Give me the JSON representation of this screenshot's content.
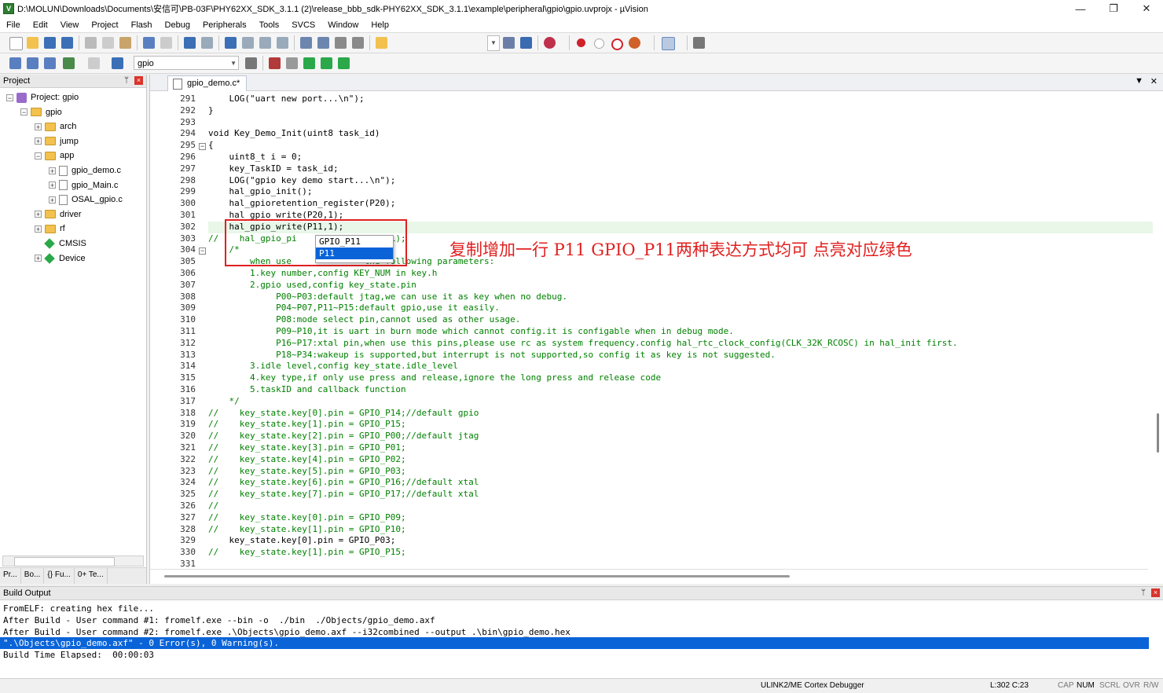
{
  "window": {
    "title": "D:\\MOLUN\\Downloads\\Documents\\安信可\\PB-03F\\PHY62XX_SDK_3.1.1 (2)\\release_bbb_sdk-PHY62XX_SDK_3.1.1\\example\\peripheral\\gpio\\gpio.uvprojx - µVision",
    "minimize": "—",
    "maximize": "❐",
    "close": "✕"
  },
  "menu": [
    "File",
    "Edit",
    "View",
    "Project",
    "Flash",
    "Debug",
    "Peripherals",
    "Tools",
    "SVCS",
    "Window",
    "Help"
  ],
  "toolbar2": {
    "target": "gpio"
  },
  "project_panel": {
    "title": "Project",
    "pin": "ᛘ",
    "close": "×",
    "tree": [
      {
        "label": "Project: gpio",
        "level": 0,
        "kind": "project",
        "exp": "−"
      },
      {
        "label": "gpio",
        "level": 1,
        "kind": "target",
        "exp": "−"
      },
      {
        "label": "arch",
        "level": 2,
        "kind": "folder",
        "exp": "+"
      },
      {
        "label": "jump",
        "level": 2,
        "kind": "folder",
        "exp": "+"
      },
      {
        "label": "app",
        "level": 2,
        "kind": "folder",
        "exp": "−"
      },
      {
        "label": "gpio_demo.c",
        "level": 3,
        "kind": "file",
        "exp": "+"
      },
      {
        "label": "gpio_Main.c",
        "level": 3,
        "kind": "file",
        "exp": "+"
      },
      {
        "label": "OSAL_gpio.c",
        "level": 3,
        "kind": "file",
        "exp": "+"
      },
      {
        "label": "driver",
        "level": 2,
        "kind": "folder",
        "exp": "+"
      },
      {
        "label": "rf",
        "level": 2,
        "kind": "folder",
        "exp": "+"
      },
      {
        "label": "CMSIS",
        "level": 2,
        "kind": "gem",
        "exp": ""
      },
      {
        "label": "Device",
        "level": 2,
        "kind": "gem",
        "exp": "+"
      }
    ],
    "tabs": [
      "Pr...",
      "Bo...",
      "{} Fu...",
      "0+ Te..."
    ]
  },
  "editor": {
    "tab_label": "gpio_demo.c*",
    "highlight_line": "302",
    "lines": [
      {
        "n": "291",
        "t": "    LOG(\"uart new port...\\n\");"
      },
      {
        "n": "292",
        "t": "}"
      },
      {
        "n": "293",
        "t": ""
      },
      {
        "n": "294",
        "t": "void Key_Demo_Init(uint8 task_id)"
      },
      {
        "n": "295",
        "t": "{"
      },
      {
        "n": "296",
        "t": "    uint8_t i = 0;"
      },
      {
        "n": "297",
        "t": "    key_TaskID = task_id;"
      },
      {
        "n": "298",
        "t": "    LOG(\"gpio key demo start...\\n\");"
      },
      {
        "n": "299",
        "t": "    hal_gpio_init();"
      },
      {
        "n": "300",
        "t": "    hal_gpioretention_register(P20);"
      },
      {
        "n": "301",
        "t": "    hal_gpio_write(P20,1);"
      },
      {
        "n": "302",
        "t": "    hal_gpio_write(P11,1);"
      },
      {
        "n": "303",
        "t": "//    hal_gpio_pi              P21,1);"
      },
      {
        "n": "304",
        "t": "    /*"
      },
      {
        "n": "305",
        "t": "        when use              the following parameters:"
      },
      {
        "n": "306",
        "t": "        1.key number,config KEY_NUM in key.h"
      },
      {
        "n": "307",
        "t": "        2.gpio used,config key_state.pin"
      },
      {
        "n": "308",
        "t": "             P00~P03:default jtag,we can use it as key when no debug."
      },
      {
        "n": "309",
        "t": "             P04~P07,P11~P15:default gpio,use it easily."
      },
      {
        "n": "310",
        "t": "             P08:mode select pin,cannot used as other usage."
      },
      {
        "n": "311",
        "t": "             P09~P10,it is uart in burn mode which cannot config.it is configable when in debug mode."
      },
      {
        "n": "312",
        "t": "             P16~P17:xtal pin,when use this pins,please use rc as system frequency.config hal_rtc_clock_config(CLK_32K_RCOSC) in hal_init first."
      },
      {
        "n": "313",
        "t": "             P18~P34:wakeup is supported,but interrupt is not supported,so config it as key is not suggested."
      },
      {
        "n": "314",
        "t": "        3.idle level,config key_state.idle_level"
      },
      {
        "n": "315",
        "t": "        4.key type,if only use press and release,ignore the long press and release code"
      },
      {
        "n": "316",
        "t": "        5.taskID and callback function"
      },
      {
        "n": "317",
        "t": "    */"
      },
      {
        "n": "318",
        "t": "//    key_state.key[0].pin = GPIO_P14;//default gpio"
      },
      {
        "n": "319",
        "t": "//    key_state.key[1].pin = GPIO_P15;"
      },
      {
        "n": "320",
        "t": "//    key_state.key[2].pin = GPIO_P00;//default jtag"
      },
      {
        "n": "321",
        "t": "//    key_state.key[3].pin = GPIO_P01;"
      },
      {
        "n": "322",
        "t": "//    key_state.key[4].pin = GPIO_P02;"
      },
      {
        "n": "323",
        "t": "//    key_state.key[5].pin = GPIO_P03;"
      },
      {
        "n": "324",
        "t": "//    key_state.key[6].pin = GPIO_P16;//default xtal"
      },
      {
        "n": "325",
        "t": "//    key_state.key[7].pin = GPIO_P17;//default xtal"
      },
      {
        "n": "326",
        "t": "//"
      },
      {
        "n": "327",
        "t": "//    key_state.key[0].pin = GPIO_P09;"
      },
      {
        "n": "328",
        "t": "//    key_state.key[1].pin = GPIO_P10;"
      },
      {
        "n": "329",
        "t": "    key_state.key[0].pin = GPIO_P03;"
      },
      {
        "n": "330",
        "t": "//    key_state.key[1].pin = GPIO_P15;"
      },
      {
        "n": "331",
        "t": ""
      }
    ],
    "autocomplete": [
      "GPIO_P11",
      "P11"
    ],
    "annotation": "复制增加一行 P11 GPIO_P11两种表达方式均可 点亮对应绿色"
  },
  "build_output": {
    "title": "Build Output",
    "lines": [
      "FromELF: creating hex file...",
      "After Build - User command #1: fromelf.exe --bin -o  ./bin  ./Objects/gpio_demo.axf",
      "After Build - User command #2: fromelf.exe .\\Objects\\gpio_demo.axf --i32combined --output .\\bin\\gpio_demo.hex",
      "\".\\Objects\\gpio_demo.axf\" - 0 Error(s), 0 Warning(s).",
      "Build Time Elapsed:  00:00:03"
    ],
    "selected_index": 3
  },
  "status": {
    "debugger": "ULINK2/ME Cortex Debugger",
    "position": "L:302 C:23",
    "cap": "CAP",
    "num": "NUM",
    "scrl": "SCRL",
    "ovr": "OVR",
    "rw": "R/W"
  },
  "colors": {
    "accent": "#0a64d8",
    "annotation": "#e02020",
    "keyword": "#0000ff",
    "string": "#a31515",
    "comment": "#008000"
  }
}
